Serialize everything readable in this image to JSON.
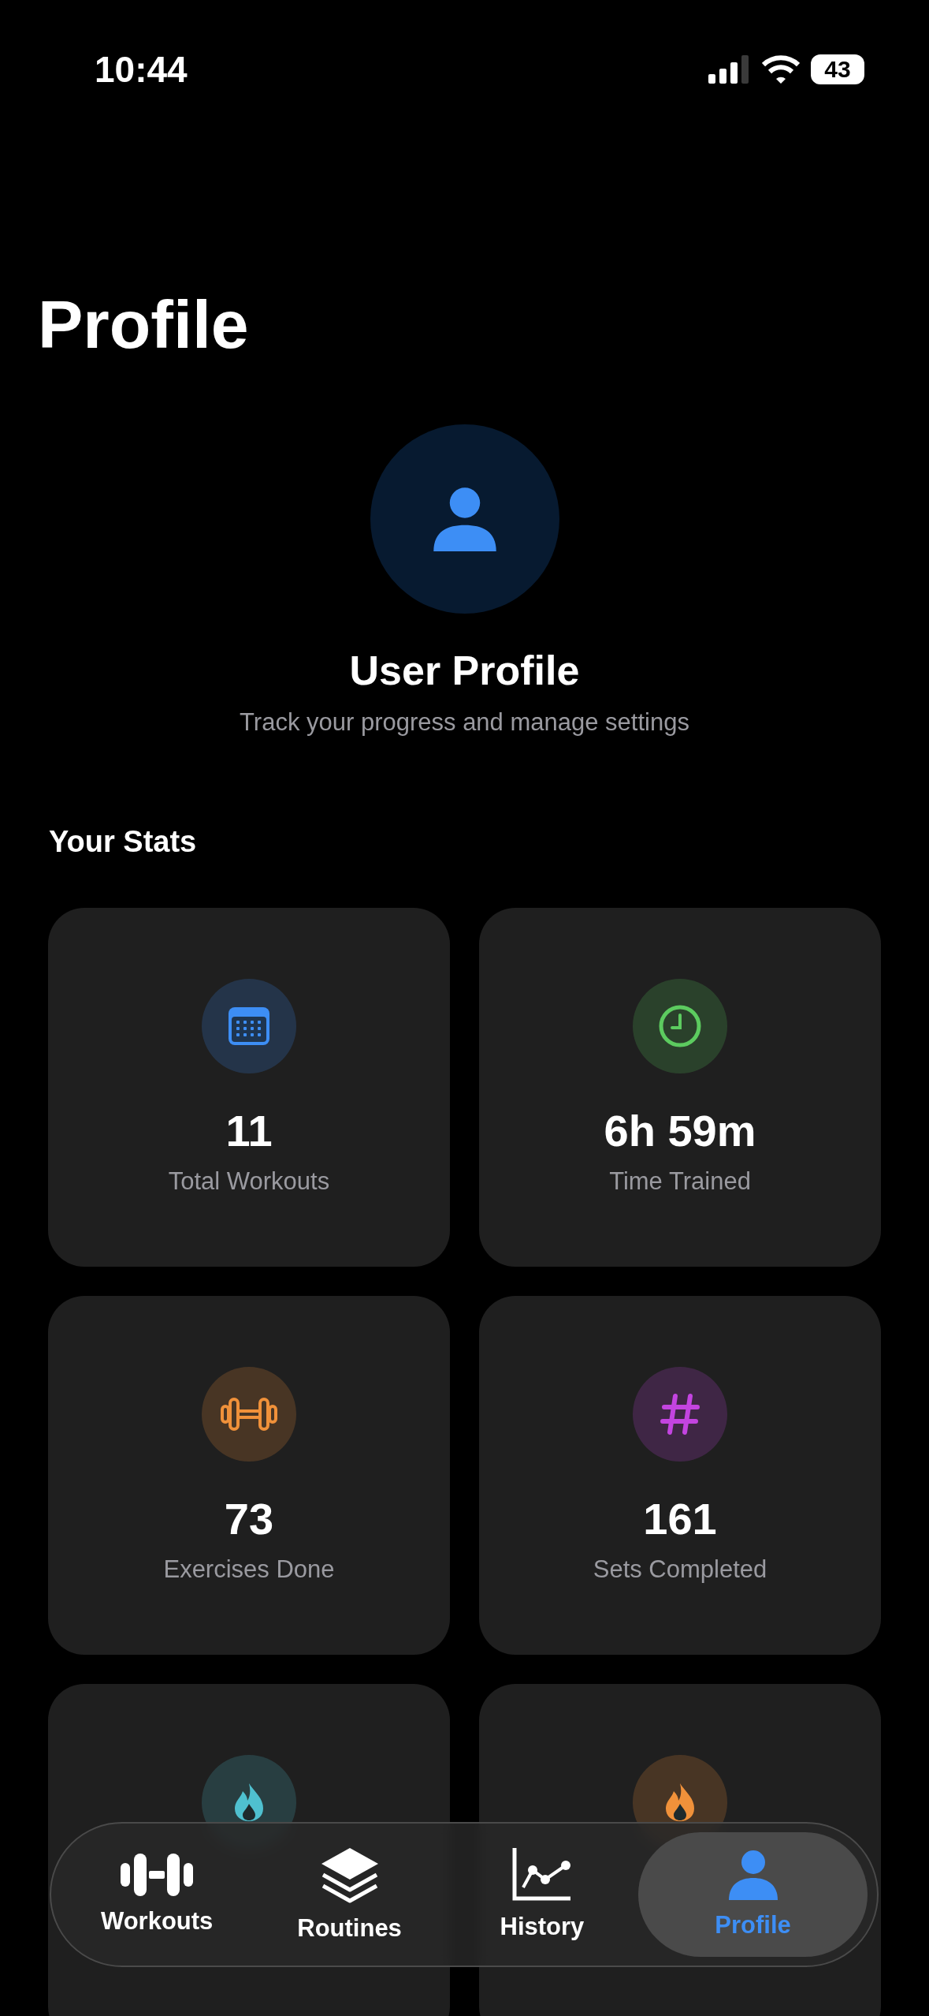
{
  "status_bar": {
    "time": "10:44",
    "battery": "43"
  },
  "title": "Profile",
  "profile": {
    "name": "User Profile",
    "subtitle": "Track your progress and manage settings"
  },
  "stats_heading": "Your Stats",
  "stats": [
    {
      "kind": "calendar",
      "color": "#3d8ef5",
      "value": "11",
      "label": "Total Workouts"
    },
    {
      "kind": "clock",
      "color": "#5ccb5f",
      "value": "6h 59m",
      "label": "Time Trained"
    },
    {
      "kind": "dumbbell",
      "color": "#f0913a",
      "value": "73",
      "label": "Exercises Done"
    },
    {
      "kind": "hash",
      "color": "#c344e0",
      "value": "161",
      "label": "Sets Completed"
    },
    {
      "kind": "flame",
      "color": "#4fc0cf"
    },
    {
      "kind": "flame",
      "color": "#f0913a"
    }
  ],
  "tabs": [
    {
      "kind": "dumbbell",
      "label": "Workouts",
      "selected": false
    },
    {
      "kind": "stack",
      "label": "Routines",
      "selected": false
    },
    {
      "kind": "chart",
      "label": "History",
      "selected": false
    },
    {
      "kind": "person",
      "label": "Profile",
      "selected": true
    }
  ]
}
